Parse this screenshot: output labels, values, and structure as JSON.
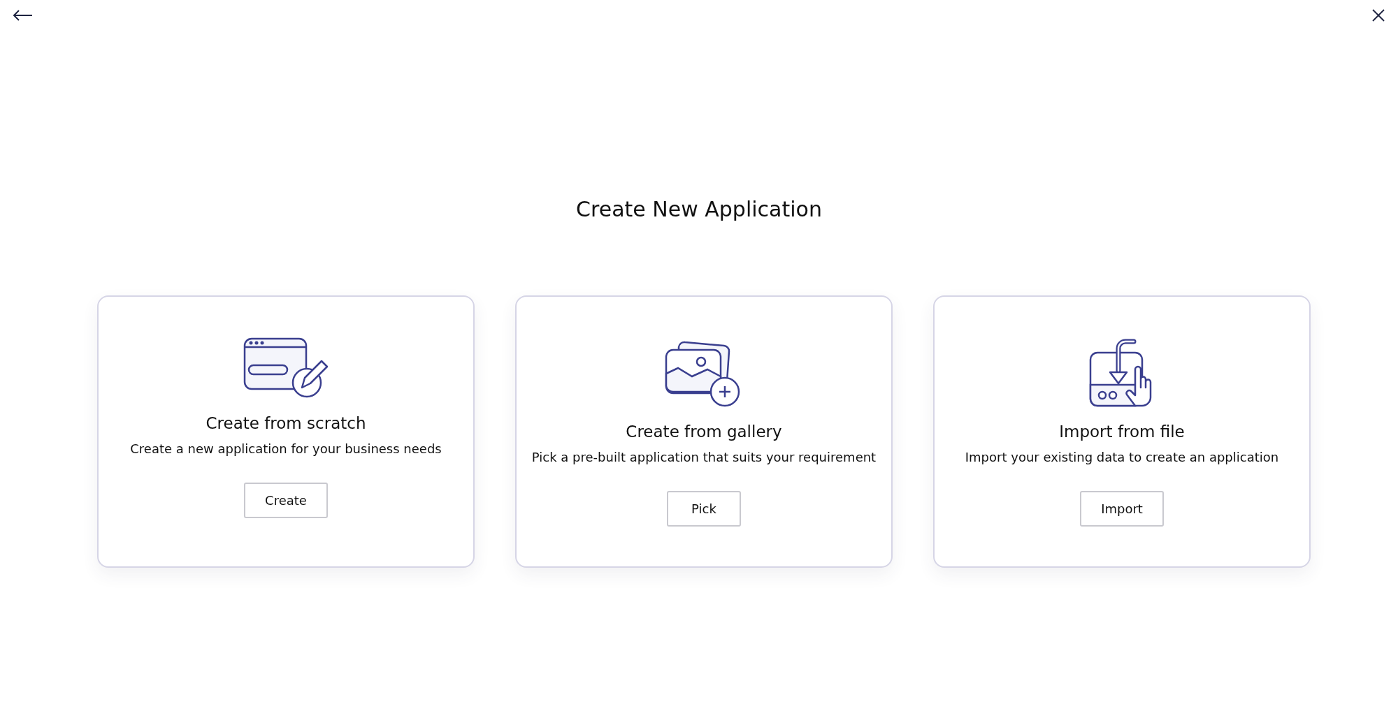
{
  "title": "Create New Application",
  "options": [
    {
      "kind": "scratch",
      "title": "Create from scratch",
      "description": "Create a new application for your business needs",
      "button": "Create"
    },
    {
      "kind": "gallery",
      "title": "Create from gallery",
      "description": "Pick a pre-built application that suits your requirement",
      "button": "Pick"
    },
    {
      "kind": "import",
      "title": "Import from file",
      "description": "Import your existing data to create an application",
      "button": "Import"
    }
  ]
}
